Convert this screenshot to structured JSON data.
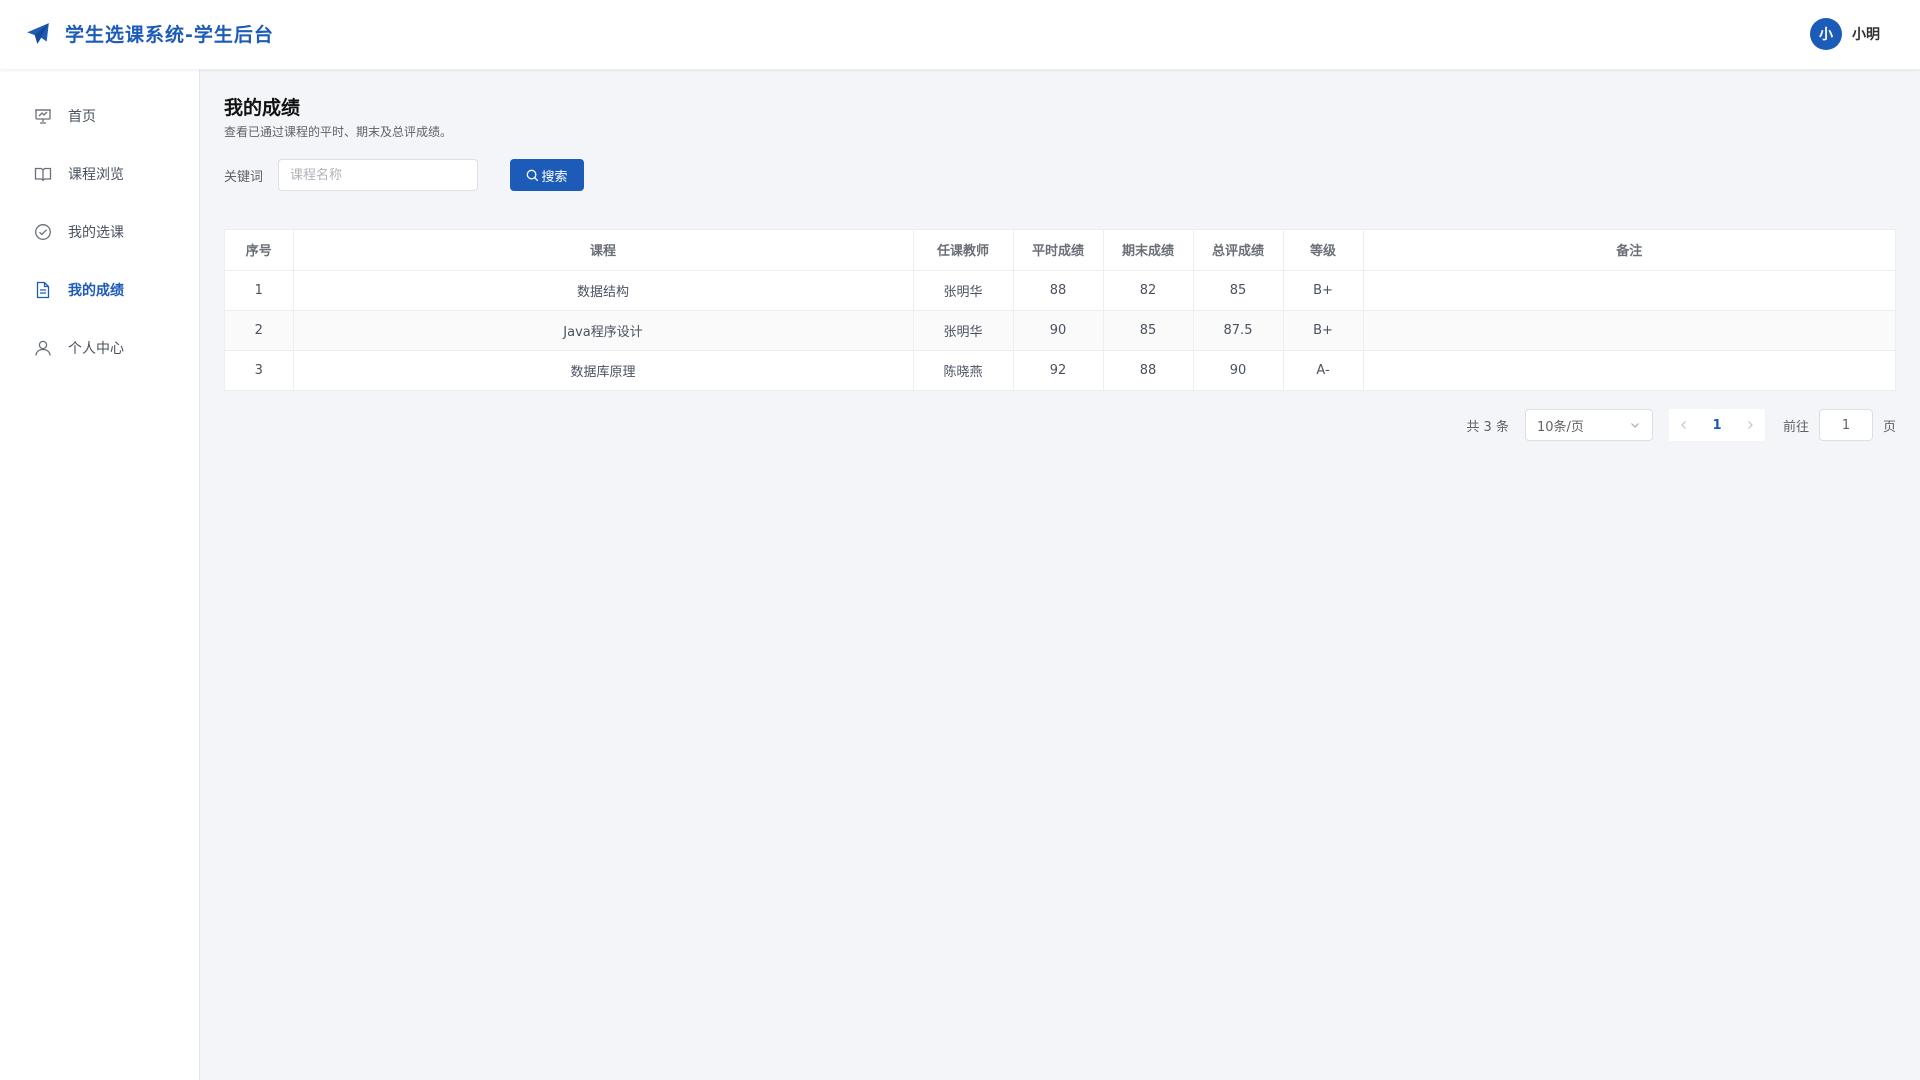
{
  "header": {
    "brand_icon": "paper-plane-icon",
    "title": "学生选课系统-学生后台",
    "avatar_text": "小",
    "username": "小明",
    "accent": "#1c5bb8"
  },
  "sidebar": {
    "items": [
      {
        "label": "首页",
        "icon": "presentation-icon",
        "active": false
      },
      {
        "label": "课程浏览",
        "icon": "book-icon",
        "active": false
      },
      {
        "label": "我的选课",
        "icon": "check-circle-icon",
        "active": false
      },
      {
        "label": "我的成绩",
        "icon": "document-icon",
        "active": true
      },
      {
        "label": "个人中心",
        "icon": "user-icon",
        "active": false
      }
    ]
  },
  "main": {
    "title": "我的成绩",
    "subtitle": "查看已通过课程的平时、期末及总评成绩。",
    "search": {
      "label": "关键词",
      "placeholder": "课程名称",
      "value": "",
      "button_label": "搜索",
      "button_icon": "search-icon"
    },
    "table": {
      "columns": [
        "序号",
        "课程",
        "任课教师",
        "平时成绩",
        "期末成绩",
        "总评成绩",
        "等级",
        "备注"
      ],
      "rows": [
        [
          "1",
          "数据结构",
          "张明华",
          "88",
          "82",
          "85",
          "B+",
          ""
        ],
        [
          "2",
          "Java程序设计",
          "张明华",
          "90",
          "85",
          "87.5",
          "B+",
          ""
        ],
        [
          "3",
          "数据库原理",
          "陈晓燕",
          "92",
          "88",
          "90",
          "A-",
          ""
        ]
      ]
    },
    "pagination": {
      "total": "共 3 条",
      "page_size": "10条/页",
      "current_page": "1",
      "goto_label": "前往",
      "goto_value": "1",
      "goto_suffix": "页"
    }
  }
}
